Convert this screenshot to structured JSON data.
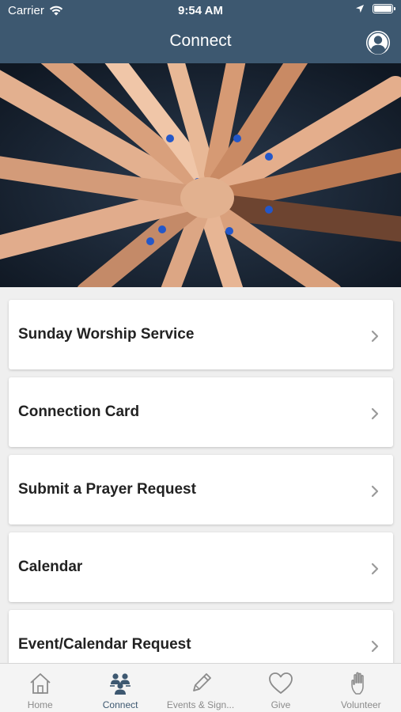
{
  "status_bar": {
    "carrier": "Carrier",
    "time": "9:54 AM",
    "battery_level": 1.0
  },
  "nav": {
    "title": "Connect",
    "profile_icon": "person-circle-icon"
  },
  "hero": {
    "description_icon": "team-hands-photo"
  },
  "menu": [
    {
      "label": "Sunday Worship Service",
      "icon": "chevron-right-icon"
    },
    {
      "label": "Connection Card",
      "icon": "chevron-right-icon"
    },
    {
      "label": "Submit a Prayer Request",
      "icon": "chevron-right-icon"
    },
    {
      "label": "Calendar",
      "icon": "chevron-right-icon"
    },
    {
      "label": "Event/Calendar Request",
      "icon": "chevron-right-icon"
    }
  ],
  "tabs": [
    {
      "label": "Home",
      "icon": "home-icon",
      "active": false
    },
    {
      "label": "Connect",
      "icon": "people-icon",
      "active": true
    },
    {
      "label": "Events & Sign...",
      "icon": "pencil-icon",
      "active": false
    },
    {
      "label": "Give",
      "icon": "heart-icon",
      "active": false
    },
    {
      "label": "Volunteer",
      "icon": "hand-icon",
      "active": false
    }
  ],
  "colors": {
    "header": "#3d5870",
    "tab_active": "#3d5870",
    "tab_inactive": "#8b8b8b",
    "background": "#efefef"
  }
}
